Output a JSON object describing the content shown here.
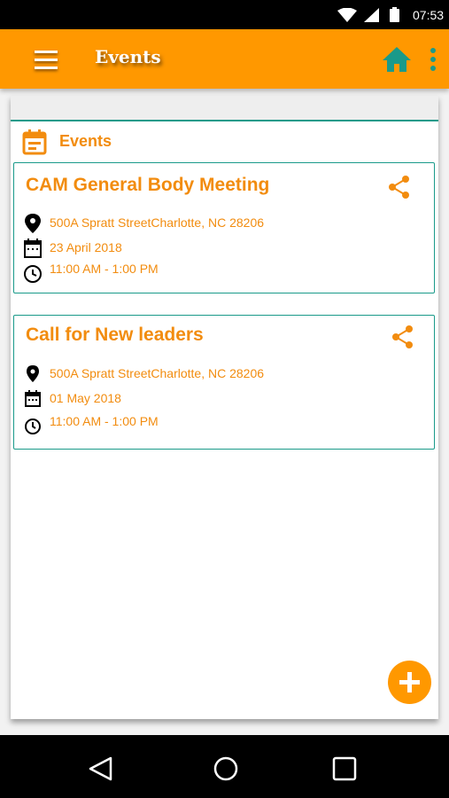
{
  "status_bar": {
    "time": "07:53"
  },
  "app_bar": {
    "title": "Events",
    "menu_icon": "hamburger-menu-icon",
    "home_icon": "home-icon",
    "more_icon": "more-vert-icon",
    "home_icon_color": "#1a9a8a",
    "background_color": "#ff9800"
  },
  "section": {
    "label": "Events",
    "icon": "calendar-icon"
  },
  "events": [
    {
      "title": "CAM General Body Meeting",
      "address": "500A Spratt StreetCharlotte, NC 28206",
      "date": "23 April 2018",
      "time": "11:00 AM - 1:00 PM"
    },
    {
      "title": "Call for New leaders",
      "address": "500A Spratt StreetCharlotte, NC 28206",
      "date": "01 May 2018",
      "time": "11:00 AM - 1:00 PM"
    }
  ],
  "fab": {
    "icon": "add-icon"
  },
  "nav_bar": {
    "back_icon": "back-triangle-icon",
    "home_icon": "home-circle-icon",
    "recents_icon": "recents-square-icon"
  },
  "colors": {
    "accent": "#f28c0f",
    "teal": "#1a9a8a"
  }
}
